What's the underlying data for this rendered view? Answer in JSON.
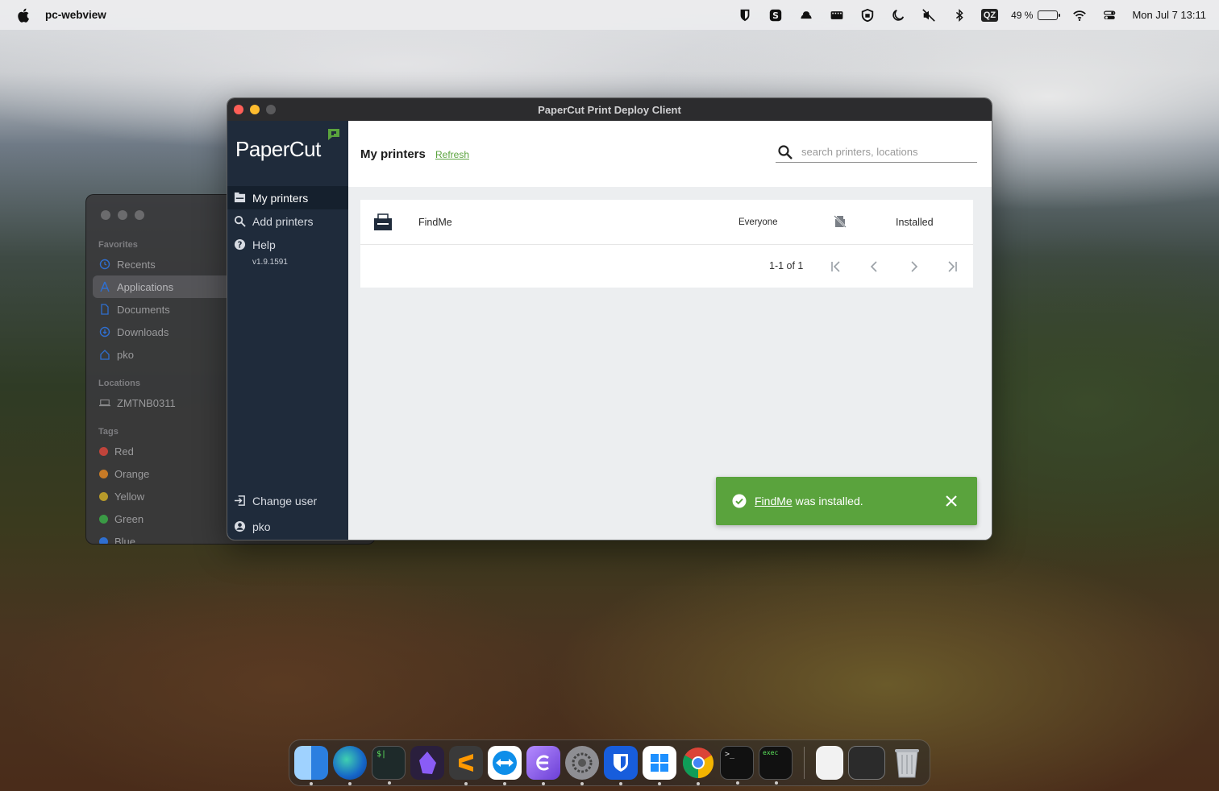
{
  "menubar": {
    "app_name": "pc-webview",
    "battery_percent": "49 %",
    "battery_level": 0.49,
    "qz_label": "QZ",
    "datetime": "Mon Jul 7  13:11",
    "status_icons": [
      "bitwarden-icon",
      "s-icon",
      "cloud-icon",
      "keyboard-icon",
      "shield-icon",
      "moon-icon",
      "mute-icon",
      "bluetooth-icon",
      "qz-icon",
      "battery-icon",
      "wifi-icon",
      "control-center-icon"
    ]
  },
  "finder": {
    "favorites_heading": "Favorites",
    "favorites": [
      {
        "label": "Recents",
        "icon": "clock-icon"
      },
      {
        "label": "Applications",
        "icon": "applications-icon"
      },
      {
        "label": "Documents",
        "icon": "document-icon"
      },
      {
        "label": "Downloads",
        "icon": "download-icon"
      },
      {
        "label": "pko",
        "icon": "home-icon"
      }
    ],
    "locations_heading": "Locations",
    "locations": [
      {
        "label": "ZMTNB0311",
        "icon": "laptop-icon"
      }
    ],
    "tags_heading": "Tags",
    "tags": [
      {
        "label": "Red",
        "color": "#c0443b"
      },
      {
        "label": "Orange",
        "color": "#c77a26"
      },
      {
        "label": "Yellow",
        "color": "#b79a2a"
      },
      {
        "label": "Green",
        "color": "#3a9a45"
      },
      {
        "label": "Blue",
        "color": "#2f6fd0"
      }
    ]
  },
  "papercut": {
    "window_title": "PaperCut Print Deploy Client",
    "logo_text": "PaperCut",
    "brand_green": "#5aa33d",
    "nav": {
      "my_printers": "My printers",
      "add_printers": "Add printers",
      "help": "Help",
      "version": "v1.9.1591",
      "change_user": "Change user",
      "user": "pko"
    },
    "header": {
      "title": "My printers",
      "refresh": "Refresh",
      "search_placeholder": "search printers, locations"
    },
    "printers": [
      {
        "name": "FindMe",
        "group": "Everyone",
        "status": "Installed"
      }
    ],
    "pagination": {
      "count": "1-1 of 1"
    },
    "toast": {
      "link": "FindMe",
      "message": " was installed."
    }
  },
  "dock": {
    "apps": [
      "finder-icon",
      "edge-icon",
      "terminal-icon",
      "obsidian-icon",
      "sublime-icon",
      "teamviewer-icon",
      "elvanto-icon",
      "system-settings-icon",
      "bitwarden-icon",
      "windows-app-icon",
      "chrome-icon",
      "terminal-icon",
      "exec-icon"
    ],
    "terminal_label": ">_",
    "exec_label": "exec",
    "shell_label": "$|"
  }
}
